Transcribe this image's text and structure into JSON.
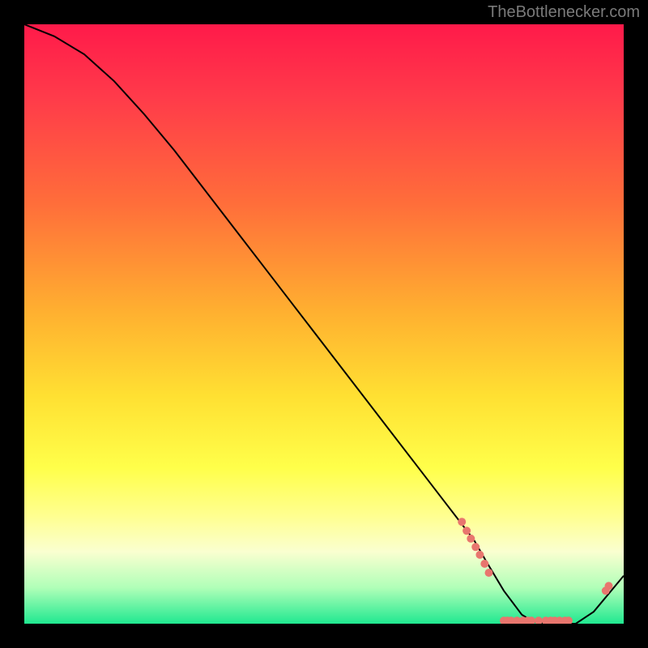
{
  "attribution": "TheBottlenecker.com",
  "chart_data": {
    "type": "line",
    "title": "",
    "xlabel": "",
    "ylabel": "",
    "xlim": [
      0,
      100
    ],
    "ylim": [
      0,
      100
    ],
    "series": [
      {
        "name": "bottleneck-curve",
        "x": [
          0,
          5,
          10,
          15,
          20,
          25,
          30,
          35,
          40,
          45,
          50,
          55,
          60,
          65,
          70,
          75,
          77,
          80,
          83,
          85,
          88,
          90,
          92,
          95,
          100
        ],
        "y": [
          100,
          98,
          95,
          90.5,
          85,
          79,
          72.5,
          66,
          59.5,
          53,
          46.5,
          40,
          33.5,
          27,
          20.5,
          14,
          10.5,
          5.5,
          1.5,
          0.3,
          0,
          0,
          0,
          2,
          8
        ]
      }
    ],
    "scatter_points": {
      "name": "highlighted-points",
      "points": [
        {
          "x": 73,
          "y": 17
        },
        {
          "x": 73.8,
          "y": 15.5
        },
        {
          "x": 74.5,
          "y": 14.2
        },
        {
          "x": 75.3,
          "y": 12.8
        },
        {
          "x": 76,
          "y": 11.5
        },
        {
          "x": 76.8,
          "y": 10
        },
        {
          "x": 77.5,
          "y": 8.5
        },
        {
          "x": 80,
          "y": 0.5
        },
        {
          "x": 80.6,
          "y": 0.5
        },
        {
          "x": 81.2,
          "y": 0.5
        },
        {
          "x": 82.2,
          "y": 0.5
        },
        {
          "x": 83.2,
          "y": 0.5
        },
        {
          "x": 84,
          "y": 0.5
        },
        {
          "x": 84.6,
          "y": 0.5
        },
        {
          "x": 85.8,
          "y": 0.5
        },
        {
          "x": 87,
          "y": 0.5
        },
        {
          "x": 87.8,
          "y": 0.5
        },
        {
          "x": 88.5,
          "y": 0.5
        },
        {
          "x": 89.3,
          "y": 0.5
        },
        {
          "x": 90.2,
          "y": 0.5
        },
        {
          "x": 90.8,
          "y": 0.5
        },
        {
          "x": 97,
          "y": 5.5
        },
        {
          "x": 97.5,
          "y": 6.3
        }
      ]
    },
    "colors": {
      "curve": "#000000",
      "dots": "#e8766e",
      "gradient_top": "#ff1a4a",
      "gradient_bottom": "#20e890"
    }
  }
}
